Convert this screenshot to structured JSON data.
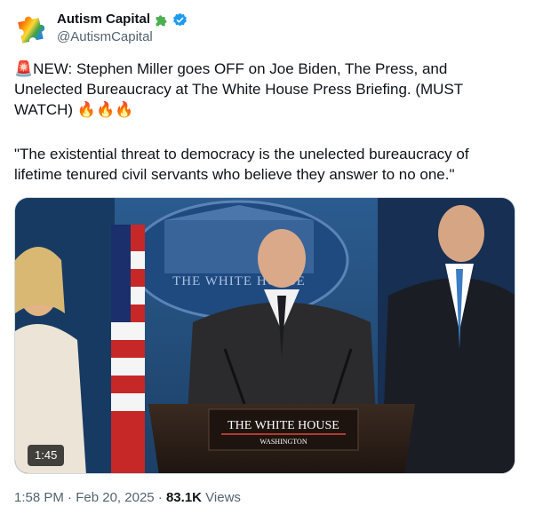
{
  "author": {
    "display_name": "Autism Capital",
    "handle": "@AutismCapital",
    "avatar_icon": "rainbow-puzzle-piece-icon",
    "name_emoji_icon": "puzzle-piece-icon",
    "verified_icon": "verified-badge-icon"
  },
  "tweet": {
    "line1": "🚨NEW: Stephen Miller goes OFF on Joe Biden, The Press, and",
    "line2": "Unelected Bureaucracy at The White House Press Briefing. (MUST",
    "line3": "WATCH) 🔥🔥🔥",
    "quote1": "\"The existential threat to democracy is the unelected bureaucracy of",
    "quote2": "lifetime tenured civil servants who believe they answer to no one.\""
  },
  "media": {
    "duration": "1:45",
    "seal_text": "THE WHITE HOUSE",
    "podium_title": "THE WHITE HOUSE",
    "podium_subtitle": "WASHINGTON"
  },
  "footer": {
    "time": "1:58 PM",
    "separator": "·",
    "date": "Feb 20, 2025",
    "views_count": "83.1K",
    "views_label": "Views"
  },
  "colors": {
    "text_primary": "#0f1419",
    "text_secondary": "#536471",
    "verified_blue": "#1d9bf0",
    "border": "#cfd9de"
  }
}
